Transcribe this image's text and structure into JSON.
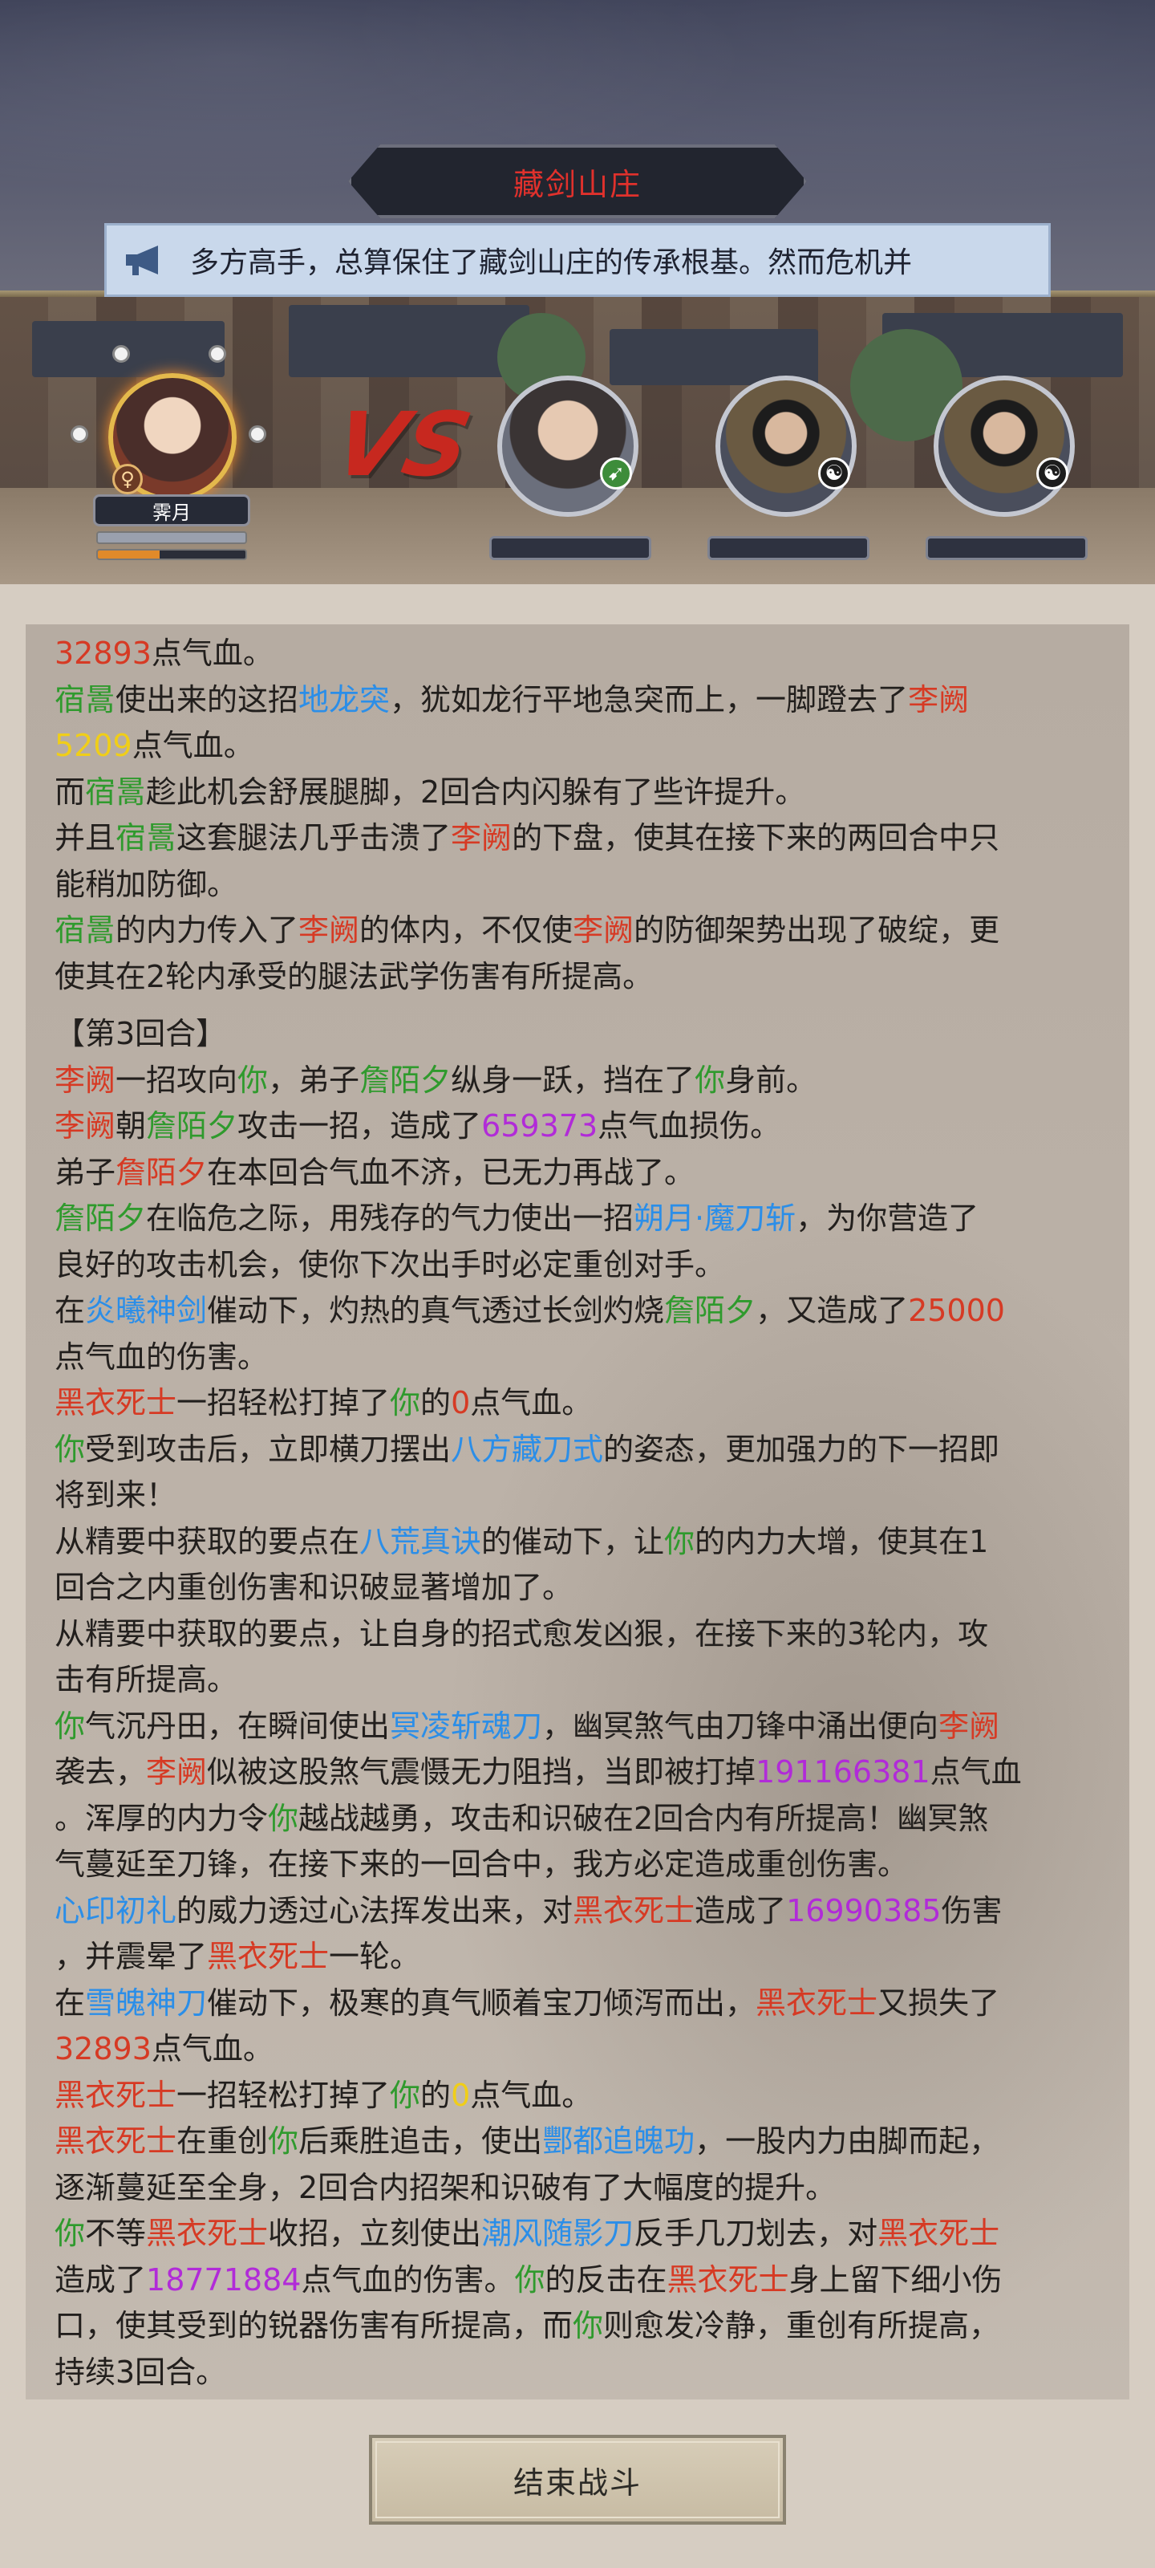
{
  "header": {
    "location_title": "藏剑山庄",
    "notice_text": "多方高手，总算保住了藏剑山庄的传承根基。然而危机并"
  },
  "battle": {
    "hero": {
      "name": "霁月",
      "gender_symbol": "♀",
      "hp_fraction": 1.0,
      "energy_fraction": 0.42
    },
    "vs_label": "VS",
    "enemies": [
      {
        "badge": "green-blade-icon"
      },
      {
        "badge": "yin-yang-icon"
      },
      {
        "badge": "yin-yang-icon"
      }
    ]
  },
  "colors": {
    "name_red": "#d63a24",
    "ally_green": "#2f9a2d",
    "skill_blue": "#2b8ee8",
    "value_yellow": "#f0ce18",
    "damage_purple": "#b12bd8"
  },
  "log": [
    [
      [
        "r",
        "32893"
      ],
      [
        "t",
        "点气血。"
      ]
    ],
    [
      [
        "g",
        "宿暠"
      ],
      [
        "t",
        "使出来的这招"
      ],
      [
        "b",
        "地龙突"
      ],
      [
        "t",
        "，犹如龙行平地急突而上，一脚蹬去了"
      ],
      [
        "r",
        "李阙"
      ]
    ],
    [
      [
        "y",
        "5209"
      ],
      [
        "t",
        "点气血。"
      ]
    ],
    [
      [
        "t",
        "而"
      ],
      [
        "g",
        "宿暠"
      ],
      [
        "t",
        "趁此机会舒展腿脚，2回合内闪躲有了些许提升。"
      ]
    ],
    [
      [
        "t",
        "并且"
      ],
      [
        "g",
        "宿暠"
      ],
      [
        "t",
        "这套腿法几乎击溃了"
      ],
      [
        "r",
        "李阙"
      ],
      [
        "t",
        "的下盘，使其在接下来的两回合中只"
      ]
    ],
    [
      [
        "t",
        "能稍加防御。"
      ]
    ],
    [
      [
        "g",
        "宿暠"
      ],
      [
        "t",
        "的内力传入了"
      ],
      [
        "r",
        "李阙"
      ],
      [
        "t",
        "的体内，不仅使"
      ],
      [
        "r",
        "李阙"
      ],
      [
        "t",
        "的防御架势出现了破绽，更"
      ]
    ],
    [
      [
        "t",
        "使其在2轮内承受的腿法武学伤害有所提高。"
      ]
    ],
    [
      [
        "gap",
        ""
      ],
      [
        "t",
        "【第3回合】"
      ]
    ],
    [
      [
        "r",
        "李阙"
      ],
      [
        "t",
        "一招攻向"
      ],
      [
        "g",
        "你"
      ],
      [
        "t",
        "，弟子"
      ],
      [
        "g",
        "詹陌夕"
      ],
      [
        "t",
        "纵身一跃，挡在了"
      ],
      [
        "g",
        "你"
      ],
      [
        "t",
        "身前。"
      ]
    ],
    [
      [
        "r",
        "李阙"
      ],
      [
        "t",
        "朝"
      ],
      [
        "g",
        "詹陌夕"
      ],
      [
        "t",
        "攻击一招，造成了"
      ],
      [
        "p",
        "659373"
      ],
      [
        "t",
        "点气血损伤。"
      ]
    ],
    [
      [
        "t",
        "弟子"
      ],
      [
        "r",
        "詹陌夕"
      ],
      [
        "t",
        "在本回合气血不济，已无力再战了。"
      ]
    ],
    [
      [
        "g",
        "詹陌夕"
      ],
      [
        "t",
        "在临危之际，用残存的气力使出一招"
      ],
      [
        "b",
        "朔月·魔刀斩"
      ],
      [
        "t",
        "，为你营造了"
      ]
    ],
    [
      [
        "t",
        "良好的攻击机会，使你下次出手时必定重创对手。"
      ]
    ],
    [
      [
        "t",
        "在"
      ],
      [
        "b",
        "炎曦神剑"
      ],
      [
        "t",
        "催动下，灼热的真气透过长剑灼烧"
      ],
      [
        "g",
        "詹陌夕"
      ],
      [
        "t",
        "，又造成了"
      ],
      [
        "r",
        "25000"
      ]
    ],
    [
      [
        "t",
        "点气血的伤害。"
      ]
    ],
    [
      [
        "r",
        "黑衣死士"
      ],
      [
        "t",
        "一招轻松打掉了"
      ],
      [
        "g",
        "你"
      ],
      [
        "t",
        "的"
      ],
      [
        "r",
        "0"
      ],
      [
        "t",
        "点气血。"
      ]
    ],
    [
      [
        "g",
        "你"
      ],
      [
        "t",
        "受到攻击后，立即横刀摆出"
      ],
      [
        "b",
        "八方藏刀式"
      ],
      [
        "t",
        "的姿态，更加强力的下一招即"
      ]
    ],
    [
      [
        "t",
        "将到来！"
      ]
    ],
    [
      [
        "t",
        "从精要中获取的要点在"
      ],
      [
        "b",
        "八荒真诀"
      ],
      [
        "t",
        "的催动下，让"
      ],
      [
        "g",
        "你"
      ],
      [
        "t",
        "的内力大增，使其在1"
      ]
    ],
    [
      [
        "t",
        "回合之内重创伤害和识破显著增加了。"
      ]
    ],
    [
      [
        "t",
        "从精要中获取的要点，让自身的招式愈发凶狠，在接下来的3轮内，攻"
      ]
    ],
    [
      [
        "t",
        "击有所提高。"
      ]
    ],
    [
      [
        "g",
        "你"
      ],
      [
        "t",
        "气沉丹田，在瞬间使出"
      ],
      [
        "b",
        "冥凌斩魂刀"
      ],
      [
        "t",
        "，幽冥煞气由刀锋中涌出便向"
      ],
      [
        "r",
        "李阙"
      ]
    ],
    [
      [
        "t",
        "袭去，"
      ],
      [
        "r",
        "李阙"
      ],
      [
        "t",
        "似被这股煞气震慑无力阻挡，当即被打掉"
      ],
      [
        "p",
        "191166381"
      ],
      [
        "t",
        "点气血"
      ]
    ],
    [
      [
        "t",
        "。浑厚的内力令"
      ],
      [
        "g",
        "你"
      ],
      [
        "t",
        "越战越勇，攻击和识破在2回合内有所提高！幽冥煞"
      ]
    ],
    [
      [
        "t",
        "气蔓延至刀锋，在接下来的一回合中，我方必定造成重创伤害。"
      ]
    ],
    [
      [
        "b",
        "心印初礼"
      ],
      [
        "t",
        "的威力透过心法挥发出来，对"
      ],
      [
        "r",
        "黑衣死士"
      ],
      [
        "t",
        "造成了"
      ],
      [
        "p",
        "16990385"
      ],
      [
        "t",
        "伤害"
      ]
    ],
    [
      [
        "t",
        "，并震晕了"
      ],
      [
        "r",
        "黑衣死士"
      ],
      [
        "t",
        "一轮。"
      ]
    ],
    [
      [
        "t",
        "在"
      ],
      [
        "b",
        "雪魄神刀"
      ],
      [
        "t",
        "催动下，极寒的真气顺着宝刀倾泻而出，"
      ],
      [
        "r",
        "黑衣死士"
      ],
      [
        "t",
        "又损失了"
      ]
    ],
    [
      [
        "r",
        "32893"
      ],
      [
        "t",
        "点气血。"
      ]
    ],
    [
      [
        "r",
        "黑衣死士"
      ],
      [
        "t",
        "一招轻松打掉了"
      ],
      [
        "g",
        "你"
      ],
      [
        "t",
        "的"
      ],
      [
        "y",
        "0"
      ],
      [
        "t",
        "点气血。"
      ]
    ],
    [
      [
        "r",
        "黑衣死士"
      ],
      [
        "t",
        "在重创"
      ],
      [
        "g",
        "你"
      ],
      [
        "t",
        "后乘胜追击，使出"
      ],
      [
        "b",
        "酆都追魄功"
      ],
      [
        "t",
        "，一股内力由脚而起，"
      ]
    ],
    [
      [
        "t",
        "逐渐蔓延至全身，2回合内招架和识破有了大幅度的提升。"
      ]
    ],
    [
      [
        "g",
        "你"
      ],
      [
        "t",
        "不等"
      ],
      [
        "r",
        "黑衣死士"
      ],
      [
        "t",
        "收招，立刻使出"
      ],
      [
        "b",
        "潮风随影刀"
      ],
      [
        "t",
        "反手几刀划去，对"
      ],
      [
        "r",
        "黑衣死士"
      ]
    ],
    [
      [
        "t",
        "造成了"
      ],
      [
        "p",
        "18771884"
      ],
      [
        "t",
        "点气血的伤害。"
      ],
      [
        "g",
        "你"
      ],
      [
        "t",
        "的反击在"
      ],
      [
        "r",
        "黑衣死士"
      ],
      [
        "t",
        "身上留下细小伤"
      ]
    ],
    [
      [
        "t",
        "口，使其受到的锐器伤害有所提高，而"
      ],
      [
        "g",
        "你"
      ],
      [
        "t",
        "则愈发冷静，重创有所提高，"
      ]
    ],
    [
      [
        "t",
        "持续3回合。"
      ]
    ]
  ],
  "footer": {
    "end_battle_label": "结束战斗"
  }
}
